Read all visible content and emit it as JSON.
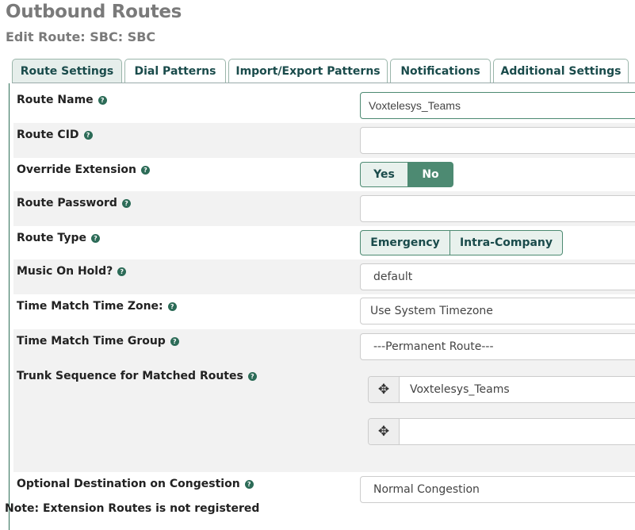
{
  "header": {
    "title": "Outbound Routes",
    "subtitle": "Edit Route: SBC: SBC"
  },
  "tabs": [
    {
      "label": "Route Settings",
      "active": true
    },
    {
      "label": "Dial Patterns"
    },
    {
      "label": "Import/Export Patterns"
    },
    {
      "label": "Notifications"
    },
    {
      "label": "Additional Settings"
    }
  ],
  "form": {
    "route_name": {
      "label": "Route Name",
      "value": "Voxtelesys_Teams"
    },
    "route_cid": {
      "label": "Route CID",
      "value": ""
    },
    "override_extension": {
      "label": "Override Extension",
      "options": [
        "Yes",
        "No"
      ],
      "selected": "No"
    },
    "route_password": {
      "label": "Route Password",
      "value": ""
    },
    "route_type": {
      "label": "Route Type",
      "options": [
        "Emergency",
        "Intra-Company"
      ]
    },
    "music_on_hold": {
      "label": "Music On Hold?",
      "value": "default"
    },
    "time_zone": {
      "label": "Time Match Time Zone:",
      "value": "Use System Timezone"
    },
    "time_group": {
      "label": "Time Match Time Group",
      "value": "---Permanent Route---"
    },
    "trunk_sequence": {
      "label": "Trunk Sequence for Matched Routes",
      "trunks": [
        "Voxtelesys_Teams",
        ""
      ]
    },
    "congestion": {
      "label": "Optional Destination on Congestion",
      "value": "Normal Congestion"
    }
  },
  "note": "Note: Extension Routes is not registered",
  "icons": {
    "help": "question-circle-icon",
    "drag": "arrows-move-icon"
  },
  "colors": {
    "accent": "#4d8a72",
    "tab_text": "#1a4b4b",
    "title": "#7a7a7a"
  }
}
